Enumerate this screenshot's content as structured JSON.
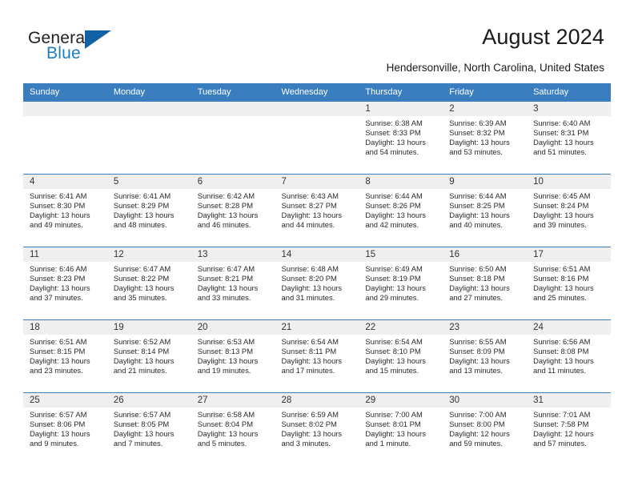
{
  "brand": {
    "name_top": "General",
    "name_bottom": "Blue",
    "accent_color": "#1162a5",
    "blue_text_color": "#1b7ec2"
  },
  "header": {
    "title": "August 2024",
    "subtitle": "Hendersonville, North Carolina, United States"
  },
  "calendar": {
    "header_bg": "#3b7ec0",
    "row_shade": "#efeff0",
    "weekdays": [
      "Sunday",
      "Monday",
      "Tuesday",
      "Wednesday",
      "Thursday",
      "Friday",
      "Saturday"
    ],
    "weeks": [
      [
        {
          "day": "",
          "blank": true
        },
        {
          "day": "",
          "blank": true
        },
        {
          "day": "",
          "blank": true
        },
        {
          "day": "",
          "blank": true
        },
        {
          "day": "1",
          "sunrise": "Sunrise: 6:38 AM",
          "sunset": "Sunset: 8:33 PM",
          "daylight_1": "Daylight: 13 hours",
          "daylight_2": "and 54 minutes."
        },
        {
          "day": "2",
          "sunrise": "Sunrise: 6:39 AM",
          "sunset": "Sunset: 8:32 PM",
          "daylight_1": "Daylight: 13 hours",
          "daylight_2": "and 53 minutes."
        },
        {
          "day": "3",
          "sunrise": "Sunrise: 6:40 AM",
          "sunset": "Sunset: 8:31 PM",
          "daylight_1": "Daylight: 13 hours",
          "daylight_2": "and 51 minutes."
        }
      ],
      [
        {
          "day": "4",
          "sunrise": "Sunrise: 6:41 AM",
          "sunset": "Sunset: 8:30 PM",
          "daylight_1": "Daylight: 13 hours",
          "daylight_2": "and 49 minutes."
        },
        {
          "day": "5",
          "sunrise": "Sunrise: 6:41 AM",
          "sunset": "Sunset: 8:29 PM",
          "daylight_1": "Daylight: 13 hours",
          "daylight_2": "and 48 minutes."
        },
        {
          "day": "6",
          "sunrise": "Sunrise: 6:42 AM",
          "sunset": "Sunset: 8:28 PM",
          "daylight_1": "Daylight: 13 hours",
          "daylight_2": "and 46 minutes."
        },
        {
          "day": "7",
          "sunrise": "Sunrise: 6:43 AM",
          "sunset": "Sunset: 8:27 PM",
          "daylight_1": "Daylight: 13 hours",
          "daylight_2": "and 44 minutes."
        },
        {
          "day": "8",
          "sunrise": "Sunrise: 6:44 AM",
          "sunset": "Sunset: 8:26 PM",
          "daylight_1": "Daylight: 13 hours",
          "daylight_2": "and 42 minutes."
        },
        {
          "day": "9",
          "sunrise": "Sunrise: 6:44 AM",
          "sunset": "Sunset: 8:25 PM",
          "daylight_1": "Daylight: 13 hours",
          "daylight_2": "and 40 minutes."
        },
        {
          "day": "10",
          "sunrise": "Sunrise: 6:45 AM",
          "sunset": "Sunset: 8:24 PM",
          "daylight_1": "Daylight: 13 hours",
          "daylight_2": "and 39 minutes."
        }
      ],
      [
        {
          "day": "11",
          "sunrise": "Sunrise: 6:46 AM",
          "sunset": "Sunset: 8:23 PM",
          "daylight_1": "Daylight: 13 hours",
          "daylight_2": "and 37 minutes."
        },
        {
          "day": "12",
          "sunrise": "Sunrise: 6:47 AM",
          "sunset": "Sunset: 8:22 PM",
          "daylight_1": "Daylight: 13 hours",
          "daylight_2": "and 35 minutes."
        },
        {
          "day": "13",
          "sunrise": "Sunrise: 6:47 AM",
          "sunset": "Sunset: 8:21 PM",
          "daylight_1": "Daylight: 13 hours",
          "daylight_2": "and 33 minutes."
        },
        {
          "day": "14",
          "sunrise": "Sunrise: 6:48 AM",
          "sunset": "Sunset: 8:20 PM",
          "daylight_1": "Daylight: 13 hours",
          "daylight_2": "and 31 minutes."
        },
        {
          "day": "15",
          "sunrise": "Sunrise: 6:49 AM",
          "sunset": "Sunset: 8:19 PM",
          "daylight_1": "Daylight: 13 hours",
          "daylight_2": "and 29 minutes."
        },
        {
          "day": "16",
          "sunrise": "Sunrise: 6:50 AM",
          "sunset": "Sunset: 8:18 PM",
          "daylight_1": "Daylight: 13 hours",
          "daylight_2": "and 27 minutes."
        },
        {
          "day": "17",
          "sunrise": "Sunrise: 6:51 AM",
          "sunset": "Sunset: 8:16 PM",
          "daylight_1": "Daylight: 13 hours",
          "daylight_2": "and 25 minutes."
        }
      ],
      [
        {
          "day": "18",
          "sunrise": "Sunrise: 6:51 AM",
          "sunset": "Sunset: 8:15 PM",
          "daylight_1": "Daylight: 13 hours",
          "daylight_2": "and 23 minutes."
        },
        {
          "day": "19",
          "sunrise": "Sunrise: 6:52 AM",
          "sunset": "Sunset: 8:14 PM",
          "daylight_1": "Daylight: 13 hours",
          "daylight_2": "and 21 minutes."
        },
        {
          "day": "20",
          "sunrise": "Sunrise: 6:53 AM",
          "sunset": "Sunset: 8:13 PM",
          "daylight_1": "Daylight: 13 hours",
          "daylight_2": "and 19 minutes."
        },
        {
          "day": "21",
          "sunrise": "Sunrise: 6:54 AM",
          "sunset": "Sunset: 8:11 PM",
          "daylight_1": "Daylight: 13 hours",
          "daylight_2": "and 17 minutes."
        },
        {
          "day": "22",
          "sunrise": "Sunrise: 6:54 AM",
          "sunset": "Sunset: 8:10 PM",
          "daylight_1": "Daylight: 13 hours",
          "daylight_2": "and 15 minutes."
        },
        {
          "day": "23",
          "sunrise": "Sunrise: 6:55 AM",
          "sunset": "Sunset: 8:09 PM",
          "daylight_1": "Daylight: 13 hours",
          "daylight_2": "and 13 minutes."
        },
        {
          "day": "24",
          "sunrise": "Sunrise: 6:56 AM",
          "sunset": "Sunset: 8:08 PM",
          "daylight_1": "Daylight: 13 hours",
          "daylight_2": "and 11 minutes."
        }
      ],
      [
        {
          "day": "25",
          "sunrise": "Sunrise: 6:57 AM",
          "sunset": "Sunset: 8:06 PM",
          "daylight_1": "Daylight: 13 hours",
          "daylight_2": "and 9 minutes."
        },
        {
          "day": "26",
          "sunrise": "Sunrise: 6:57 AM",
          "sunset": "Sunset: 8:05 PM",
          "daylight_1": "Daylight: 13 hours",
          "daylight_2": "and 7 minutes."
        },
        {
          "day": "27",
          "sunrise": "Sunrise: 6:58 AM",
          "sunset": "Sunset: 8:04 PM",
          "daylight_1": "Daylight: 13 hours",
          "daylight_2": "and 5 minutes."
        },
        {
          "day": "28",
          "sunrise": "Sunrise: 6:59 AM",
          "sunset": "Sunset: 8:02 PM",
          "daylight_1": "Daylight: 13 hours",
          "daylight_2": "and 3 minutes."
        },
        {
          "day": "29",
          "sunrise": "Sunrise: 7:00 AM",
          "sunset": "Sunset: 8:01 PM",
          "daylight_1": "Daylight: 13 hours",
          "daylight_2": "and 1 minute."
        },
        {
          "day": "30",
          "sunrise": "Sunrise: 7:00 AM",
          "sunset": "Sunset: 8:00 PM",
          "daylight_1": "Daylight: 12 hours",
          "daylight_2": "and 59 minutes."
        },
        {
          "day": "31",
          "sunrise": "Sunrise: 7:01 AM",
          "sunset": "Sunset: 7:58 PM",
          "daylight_1": "Daylight: 12 hours",
          "daylight_2": "and 57 minutes."
        }
      ]
    ]
  }
}
